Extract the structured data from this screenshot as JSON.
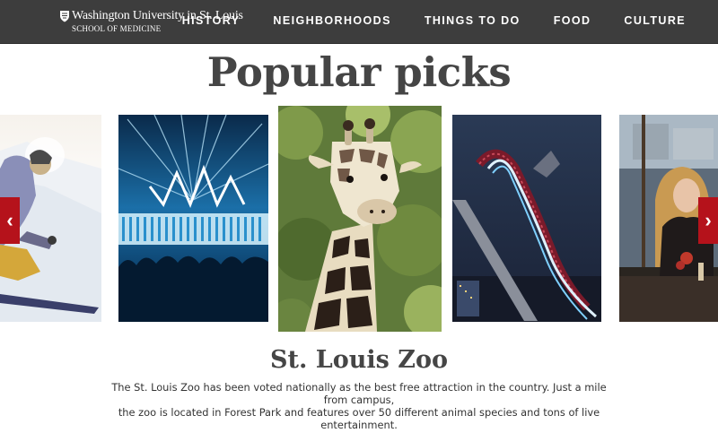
{
  "header": {
    "logo_line1": "Washington University in St. Louis",
    "logo_line2": "SCHOOL OF MEDICINE",
    "nav": [
      "HISTORY",
      "NEIGHBORHOODS",
      "THINGS TO DO",
      "FOOD",
      "CULTURE"
    ]
  },
  "main": {
    "title": "Popular picks",
    "carousel": {
      "prev_icon": "chevron-left-icon",
      "next_icon": "chevron-right-icon",
      "prev_glyph": "‹",
      "next_glyph": "›",
      "featured": {
        "title": "St. Louis Zoo",
        "description_line1": "The St. Louis Zoo has been voted nationally as the best free attraction in the country.  Just a mile from campus,",
        "description_line2": "the zoo is located in Forest Park and features over 50 different animal species and tons of live entertainment."
      }
    }
  },
  "colors": {
    "header_bg": "#3d3d3d",
    "accent": "#b5121b",
    "title_text": "#454545"
  }
}
